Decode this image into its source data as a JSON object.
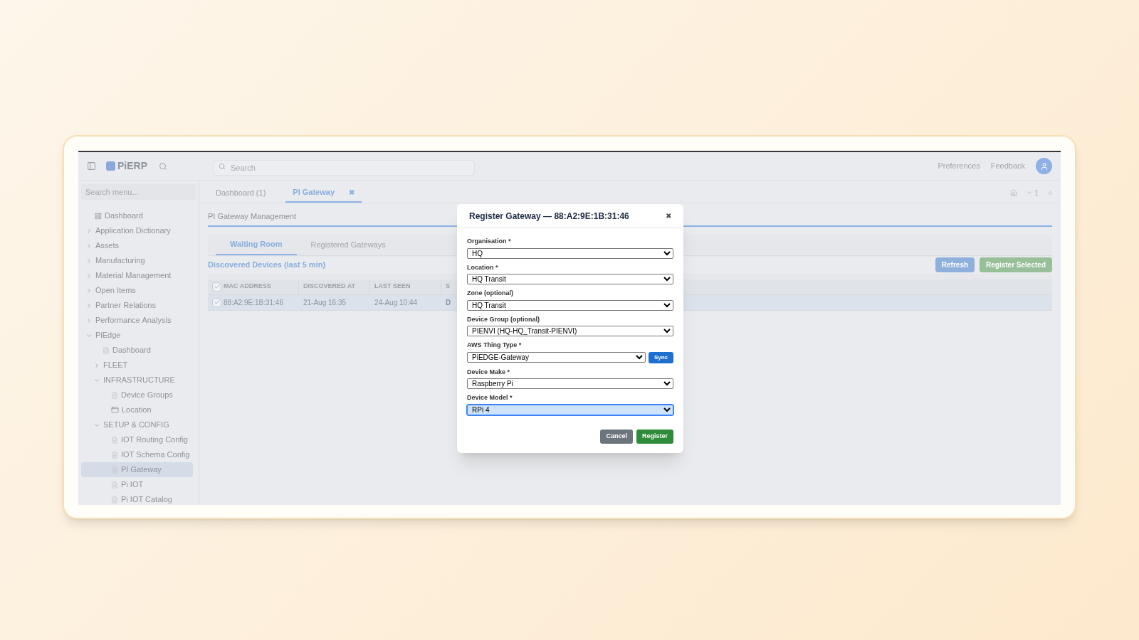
{
  "header": {
    "brand": "PiERP",
    "search": {
      "placeholder": "Search"
    },
    "links": [
      "Preferences",
      "Feedback"
    ]
  },
  "sidebar": {
    "search": {
      "placeholder": "Search menu..."
    },
    "items": [
      {
        "label": "Dashboard",
        "kind": "dashboard",
        "selected": false
      },
      {
        "label": "Application Dictionary",
        "kind": "group",
        "expanded": false
      },
      {
        "label": "Assets",
        "kind": "group",
        "expanded": false
      },
      {
        "label": "Manufacturing",
        "kind": "group",
        "expanded": false
      },
      {
        "label": "Material Management",
        "kind": "group",
        "expanded": false
      },
      {
        "label": "Open Items",
        "kind": "group",
        "expanded": false
      },
      {
        "label": "Partner Relations",
        "kind": "group",
        "expanded": false
      },
      {
        "label": "Performance Analysis",
        "kind": "group",
        "expanded": false
      },
      {
        "label": "PiEdge",
        "kind": "group",
        "expanded": true,
        "children": [
          {
            "label": "Dashboard",
            "kind": "document",
            "selected": false
          },
          {
            "label": "FLEET",
            "kind": "group",
            "expanded": false
          },
          {
            "label": "INFRASTRUCTURE",
            "kind": "group",
            "expanded": true,
            "children": [
              {
                "label": "Device Groups",
                "kind": "document",
                "selected": false
              },
              {
                "label": "Location",
                "kind": "panel",
                "selected": false
              }
            ]
          },
          {
            "label": "SETUP & CONFIG",
            "kind": "group",
            "expanded": true,
            "children": [
              {
                "label": "IOT Routing Config",
                "kind": "document",
                "selected": false
              },
              {
                "label": "IOT Schema Config",
                "kind": "document",
                "selected": false
              },
              {
                "label": "PI Gateway",
                "kind": "document",
                "selected": true
              },
              {
                "label": "Pi IOT",
                "kind": "document",
                "selected": false
              },
              {
                "label": "Pi IOT Catalog",
                "kind": "document",
                "selected": false
              }
            ]
          }
        ]
      }
    ]
  },
  "tabs": [
    {
      "label": "Dashboard (1)",
      "selected": false
    },
    {
      "label": "PI Gateway",
      "selected": true,
      "close": "✖"
    }
  ],
  "tab_tools": {
    "count": "1"
  },
  "page": {
    "title": "PI Gateway Management",
    "subtabs": [
      {
        "label": "Waiting Room",
        "selected": true
      },
      {
        "label": "Registered Gateways",
        "selected": false
      }
    ],
    "section_title": "Discovered Devices (last 5 min)",
    "buttons": [
      {
        "label": "Refresh",
        "kind": "primary"
      },
      {
        "label": "Register Selected",
        "kind": "success"
      }
    ],
    "table": {
      "all_checked": true,
      "columns": [
        "MAC ADDRESS",
        "DISCOVERED AT",
        "LAST SEEN",
        "S"
      ],
      "rows": [
        {
          "checked": true,
          "selected": true,
          "cells": [
            "88:A2:9E:1B:31:46",
            "21-Aug 16:35",
            "24-Aug 10:44",
            "D"
          ]
        }
      ]
    }
  },
  "dialog": {
    "title": "Register Gateway — 88:A2:9E:1B:31:46",
    "close": "✖",
    "fields": [
      {
        "label": "Organisation *",
        "value": "HQ",
        "kind": "select",
        "focused": false
      },
      {
        "label": "Location *",
        "value": "HQ Transit",
        "kind": "select",
        "focused": false
      },
      {
        "label": "Zone (optional)",
        "value": "HQ Transit",
        "kind": "select",
        "focused": false
      },
      {
        "label": "Device Group (optional)",
        "value": "PIENVI (HQ-HQ_Transit-PIENVI)",
        "kind": "select",
        "focused": false
      },
      {
        "label": "AWS Thing Type *",
        "value": "PiEDGE-Gateway",
        "kind": "select_sync",
        "action": "Sync",
        "focused": false
      },
      {
        "label": "Device Make *",
        "value": "Raspberry Pi",
        "kind": "select",
        "focused": false
      },
      {
        "label": "Device Model *",
        "value": "RPi 4",
        "kind": "select",
        "focused": true
      }
    ],
    "buttons": [
      {
        "label": "Cancel",
        "kind": "secondary"
      },
      {
        "label": "Register",
        "kind": "success"
      }
    ]
  }
}
